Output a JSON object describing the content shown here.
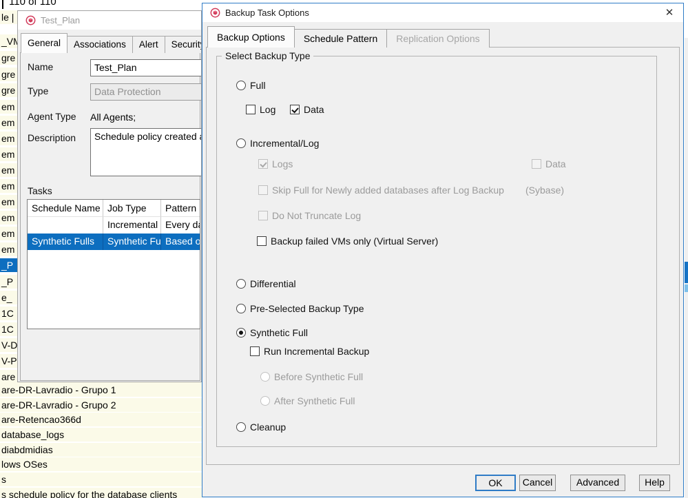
{
  "colors": {
    "accent": "#2e7bc6",
    "selection": "#0d6ebf",
    "row_bg": "#fbfae8",
    "disabled_text": "#9b9b9b"
  },
  "icons": {
    "close": "✕",
    "app": "commvault-logo"
  },
  "browser": {
    "counter": "110 of 110",
    "rows": [
      "le |",
      "_VM",
      "gre",
      "gre",
      "gre",
      "em",
      "em",
      "em",
      "em",
      "em",
      "em",
      "em",
      "em",
      "em",
      "em",
      "_P",
      "_P",
      "e_",
      "1C",
      "1C",
      "V-D",
      "V-P",
      "are",
      "are-DR-Lavradio - Grupo 1",
      "are-DR-Lavradio - Grupo 2",
      "are-Retencao366d",
      "database_logs",
      "diabdmidias",
      "lows OSes",
      "s",
      "s schedule policy for the database clients"
    ],
    "selected_row_index": 15
  },
  "plan_dialog": {
    "title": "Test_Plan",
    "tabs": [
      "General",
      "Associations",
      "Alert",
      "Security"
    ],
    "active_tab": "General",
    "fields": {
      "name_label": "Name",
      "name_value": "Test_Plan",
      "type_label": "Type",
      "type_value": "Data Protection",
      "agent_label": "Agent Type",
      "agent_value": "All Agents;",
      "desc_label": "Description",
      "desc_value": "Schedule policy created a"
    },
    "tasks_label": "Tasks",
    "table": {
      "columns": [
        "Schedule Name",
        "Job Type",
        "Pattern"
      ],
      "rows": [
        [
          "",
          "Incremental",
          "Every da"
        ],
        [
          "Synthetic Fulls",
          "Synthetic Full",
          "Based o"
        ]
      ],
      "selected_row_index": 1
    }
  },
  "task_dialog": {
    "title": "Backup Task Options",
    "tabs": [
      "Backup Options",
      "Schedule Pattern",
      "Replication Options"
    ],
    "active_tab": "Backup Options",
    "disabled_tab": "Replication Options",
    "group_title": "Select Backup Type",
    "options": {
      "full": {
        "label": "Full",
        "type": "radio",
        "checked": false,
        "disabled": false
      },
      "log": {
        "label": "Log",
        "type": "checkbox",
        "checked": false,
        "disabled": false
      },
      "data": {
        "label": "Data",
        "type": "checkbox",
        "checked": true,
        "disabled": false
      },
      "incremental": {
        "label": "Incremental/Log",
        "type": "radio",
        "checked": false,
        "disabled": false
      },
      "logs": {
        "label": "Logs",
        "type": "checkbox",
        "checked": true,
        "disabled": true
      },
      "data2": {
        "label": "Data",
        "type": "checkbox",
        "checked": false,
        "disabled": true
      },
      "skip": {
        "label": "Skip Full for Newly added databases after Log Backup",
        "type": "checkbox",
        "checked": false,
        "disabled": true
      },
      "sybase": "(Sybase)",
      "truncate": {
        "label": "Do Not Truncate Log",
        "type": "checkbox",
        "checked": false,
        "disabled": true
      },
      "failed_vms": {
        "label": "Backup failed VMs only (Virtual Server)",
        "type": "checkbox",
        "checked": false,
        "disabled": false
      },
      "differential": {
        "label": "Differential",
        "type": "radio",
        "checked": false,
        "disabled": false
      },
      "preselected": {
        "label": "Pre-Selected Backup Type",
        "type": "radio",
        "checked": false,
        "disabled": false
      },
      "synthetic": {
        "label": "Synthetic Full",
        "type": "radio",
        "checked": true,
        "disabled": false
      },
      "run_incremental": {
        "label": "Run Incremental Backup",
        "type": "checkbox",
        "checked": false,
        "disabled": false
      },
      "before": {
        "label": "Before Synthetic Full",
        "type": "radio",
        "checked": false,
        "disabled": true
      },
      "after": {
        "label": "After Synthetic Full",
        "type": "radio",
        "checked": false,
        "disabled": true
      },
      "cleanup": {
        "label": "Cleanup",
        "type": "radio",
        "checked": false,
        "disabled": false
      }
    },
    "buttons": {
      "ok": "OK",
      "cancel": "Cancel",
      "advanced": "Advanced",
      "help": "Help"
    }
  }
}
